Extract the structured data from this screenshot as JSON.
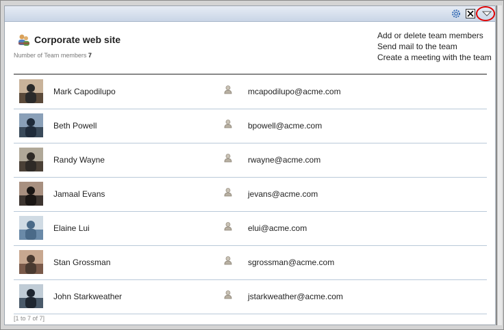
{
  "team": {
    "title": "Corporate web site",
    "member_count_label": "Number of Team members",
    "member_count": "7"
  },
  "actions": [
    "Add or delete team members",
    "Send mail to the team",
    "Create a meeting with the team"
  ],
  "titlebar_icons": [
    "gear-icon",
    "close-icon",
    "chevron-down-icon"
  ],
  "members": [
    {
      "name": "Mark Capodilupo",
      "email": "mcapodilupo@acme.com"
    },
    {
      "name": "Beth Powell",
      "email": "bpowell@acme.com"
    },
    {
      "name": "Randy Wayne",
      "email": "rwayne@acme.com"
    },
    {
      "name": "Jamaal Evans",
      "email": "jevans@acme.com"
    },
    {
      "name": "Elaine Lui",
      "email": "elui@acme.com"
    },
    {
      "name": "Stan Grossman",
      "email": "sgrossman@acme.com"
    },
    {
      "name": "John Starkweather",
      "email": "jstarkweather@acme.com"
    }
  ],
  "pager": "[1 to 7 of 7]",
  "colors": {
    "highlight": "#e00000",
    "titlebar": "#c9d5e6",
    "row_divider": "#b8c8d8"
  }
}
